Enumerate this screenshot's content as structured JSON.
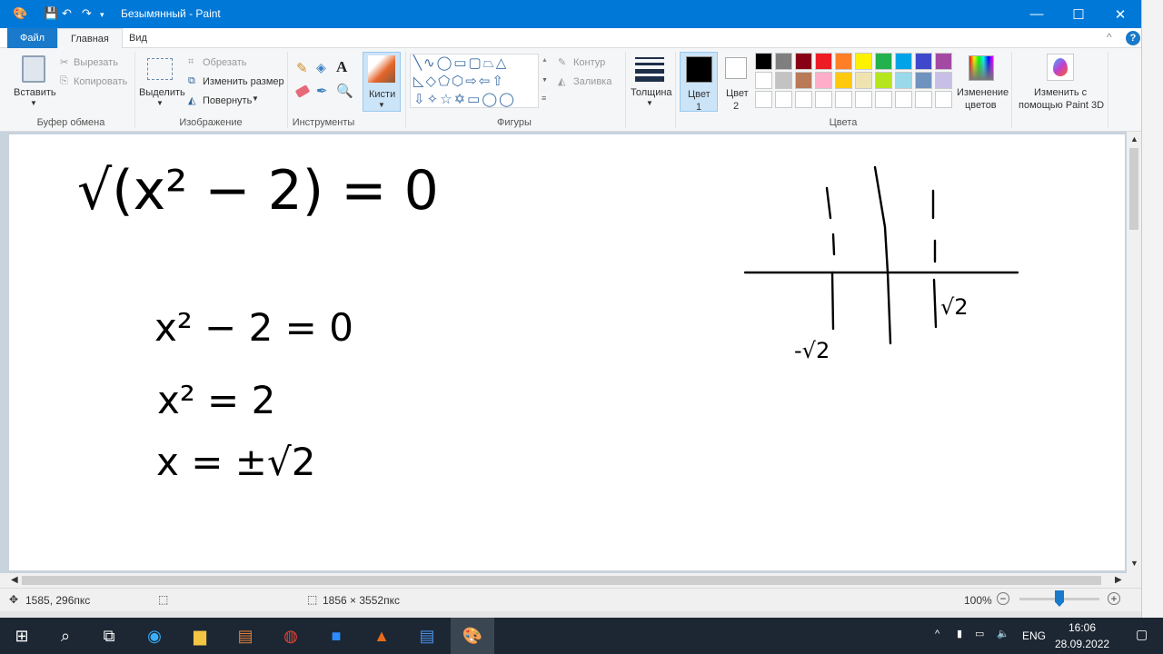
{
  "window": {
    "title": "Безымянный - Paint",
    "minimize": "—",
    "maximize": "☐",
    "close": "✕"
  },
  "tabs": [
    {
      "label": "Файл"
    },
    {
      "label": "Главная"
    },
    {
      "label": "Вид"
    }
  ],
  "ribbon": {
    "clipboard": {
      "group": "Буфер обмена",
      "paste": "Вставить",
      "cut": "Вырезать",
      "copy": "Копировать"
    },
    "image": {
      "group": "Изображение",
      "select": "Выделить",
      "crop": "Обрезать",
      "resize": "Изменить размер",
      "rotate": "Повернуть"
    },
    "tools": {
      "group": "Инструменты"
    },
    "brushes": {
      "label": "Кисти"
    },
    "shapes": {
      "group": "Фигуры",
      "outline": "Контур",
      "fill": "Заливка"
    },
    "size": {
      "label": "Толщина"
    },
    "color1": {
      "label": "Цвет",
      "num": "1",
      "value": "#000000"
    },
    "color2": {
      "label": "Цвет",
      "num": "2",
      "value": "#ffffff"
    },
    "colors": {
      "group": "Цвета",
      "edit1": "Изменение",
      "edit2": "цветов",
      "palette": [
        "#000000",
        "#7f7f7f",
        "#880015",
        "#ed1c24",
        "#ff7f27",
        "#fff200",
        "#22b14c",
        "#00a2e8",
        "#3f48cc",
        "#a349a4",
        "#ffffff",
        "#c3c3c3",
        "#b97a57",
        "#ffaec9",
        "#ffc90e",
        "#efe4b0",
        "#b5e61d",
        "#99d9ea",
        "#7092be",
        "#c8bfe7"
      ]
    },
    "paint3d": {
      "l1": "Изменить с",
      "l2": "помощью Paint 3D"
    }
  },
  "canvas": {
    "eq1": "√(x² − 2) = 0",
    "eq2": "x² − 2 = 0",
    "eq3": "x² = 2",
    "eq4": "x = ±√2",
    "neg_root": "-√2",
    "pos_root": "√2"
  },
  "status": {
    "cursor": "1585, 296пкс",
    "size": "1856 × 3552пкс",
    "zoom": "100%"
  },
  "taskbar": {
    "lang": "ENG",
    "time": "16:06",
    "date": "28.09.2022"
  }
}
